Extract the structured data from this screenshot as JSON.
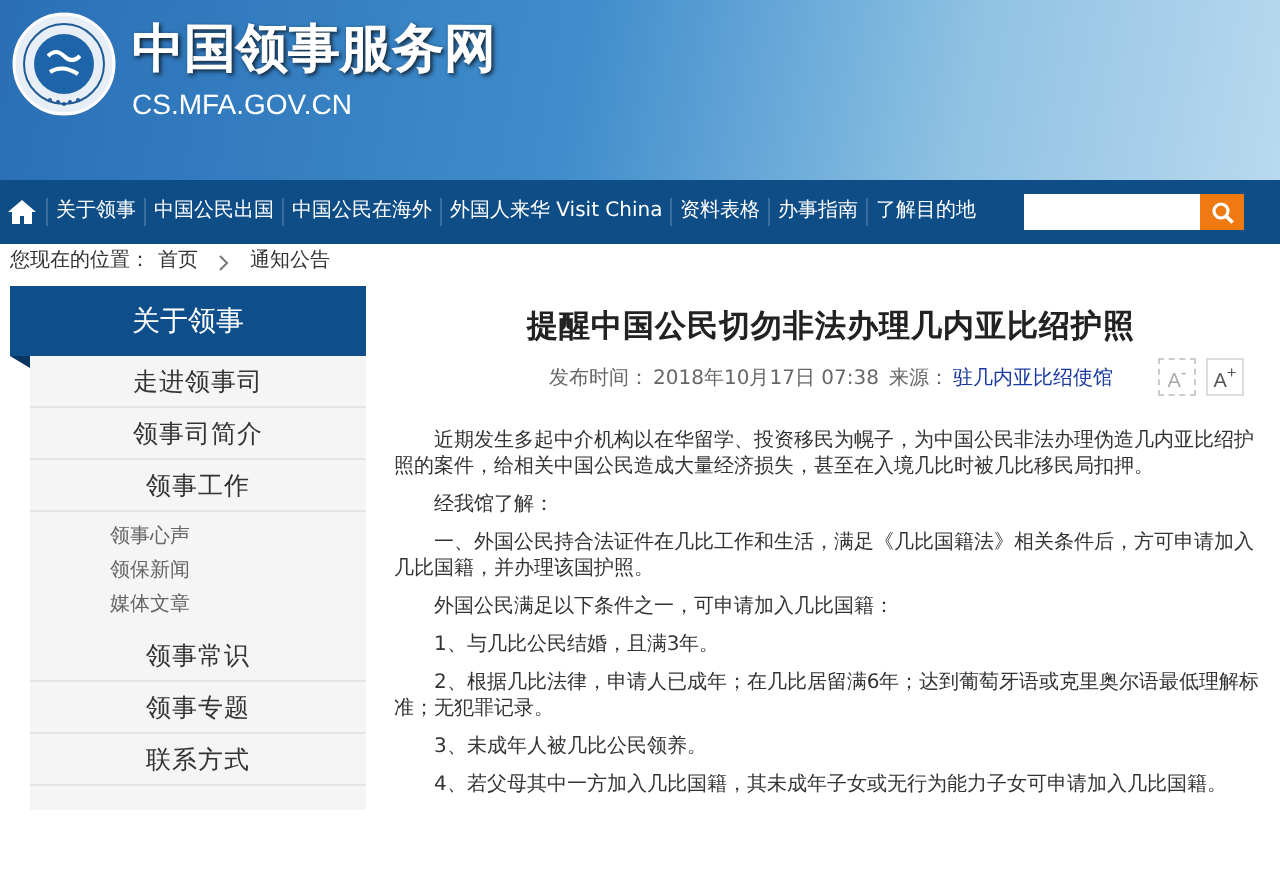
{
  "header": {
    "site_title": "中国领事服务网",
    "domain": "CS.MFA.GOV.CN"
  },
  "nav": {
    "items": [
      {
        "label": "关于领事",
        "selected": false
      },
      {
        "label": "中国公民出国",
        "selected": false
      },
      {
        "label": "中国公民在海外",
        "selected": false
      },
      {
        "label": "外国人来华 Visit China",
        "selected": false
      },
      {
        "label": "资料表格",
        "selected": false
      },
      {
        "label": "办事指南",
        "selected": false
      },
      {
        "label": "了解目的地",
        "selected": false
      }
    ]
  },
  "breadcrumb": {
    "label": "您现在的位置：",
    "items": [
      "首页",
      "通知公告"
    ]
  },
  "sidebar": {
    "title": "关于领事",
    "items": [
      {
        "label": "走进领事司",
        "selected": false
      },
      {
        "label": "领事司简介",
        "selected": false
      },
      {
        "label": "领事工作",
        "selected": false,
        "children": [
          {
            "label": "领事心声",
            "selected": false
          },
          {
            "label": "领保新闻",
            "selected": false
          },
          {
            "label": "媒体文章",
            "selected": false
          }
        ]
      },
      {
        "label": "领事常识",
        "selected": false
      },
      {
        "label": "领事专题",
        "selected": false
      },
      {
        "label": "联系方式",
        "selected": false
      }
    ]
  },
  "article": {
    "title": "提醒中国公民切勿非法办理几内亚比绍护照",
    "date_label": "发布时间：",
    "date": "2018年10月17日 07:38",
    "source_label": "来源：",
    "source": "驻几内亚比绍使馆",
    "font_buttons": [
      {
        "label": "A$^{-}$",
        "disabled": true
      },
      {
        "label": "A$^{+}$",
        "disabled": false
      }
    ],
    "paragraphs": [
      "近期发生多起中介机构以在华留学、投资移民为幌子，为中国公民非法办理伪造几内亚比绍护照的案件，给相关中国公民造成大量经济损失，甚至在入境几比时被几比移民局扣押。",
      "经我馆了解：",
      "一、外国公民持合法证件在几比工作和生活，满足《几比国籍法》相关条件后，方可申请加入几比国籍，并办理该国护照。",
      "外国公民满足以下条件之一，可申请加入几比国籍：",
      "1、与几比公民结婚，且满3年。",
      "2、根据几比法律，申请人已成年；在几比居留满6年；达到葡萄牙语或克里奥尔语最低理解标准；无犯罪记录。",
      "3、未成年人被几比公民领养。",
      "4、若父母其中一方加入几比国籍，其未成年子女或无行为能力子女可申请加入几比国籍。"
    ]
  }
}
